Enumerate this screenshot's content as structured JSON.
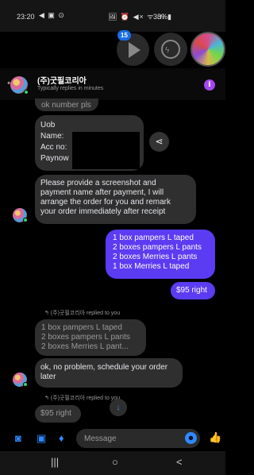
{
  "status_bar": {
    "time": "23:20",
    "left_icons": "◀ ▣ ⊙",
    "right_icons": "🖼 ⏰ ◀× ᯤ .ıl",
    "battery": "38%▮"
  },
  "chat_heads": {
    "unread_badge": "15"
  },
  "header": {
    "title": "(주)굿필코리아",
    "subtitle": "Typically replies in minutes",
    "info_icon": "i"
  },
  "messages": {
    "m1": "ok number pls",
    "m2_lines": [
      "Uob",
      "Name:",
      "Acc no:",
      "Paynow"
    ],
    "m3_lines": [
      "Please provide a screenshot and",
      "payment name after payment, I will",
      "arrange the order for you and remark",
      "your order immediately after receipt"
    ],
    "m4_lines": [
      "1 box pampers L taped",
      "2 boxes pampers L pants",
      "2 boxes Merries L pants",
      "1 box Merries L taped"
    ],
    "m5": "$95 right",
    "replied_1": "↰ (주)굿필코리아 replied to you",
    "quoted_1_lines": [
      "1 box pampers L taped",
      "2 boxes pampers L pants",
      "2 boxes Merries L pant..."
    ],
    "m6_lines": [
      "ok, no problem, schedule your order",
      "later"
    ],
    "replied_2": "↰ (주)굿필코리아 replied to you",
    "quoted_2": "$95 right"
  },
  "composer": {
    "placeholder": "Message"
  },
  "nav": {
    "recents": "|||",
    "home": "○",
    "back": "<"
  },
  "colors": {
    "accent": "#2e89ff",
    "outgoing_bubble": "#5b3cf2",
    "incoming_bubble": "#2f2f2f",
    "info": "#a347f5",
    "online": "#3bd16f"
  }
}
